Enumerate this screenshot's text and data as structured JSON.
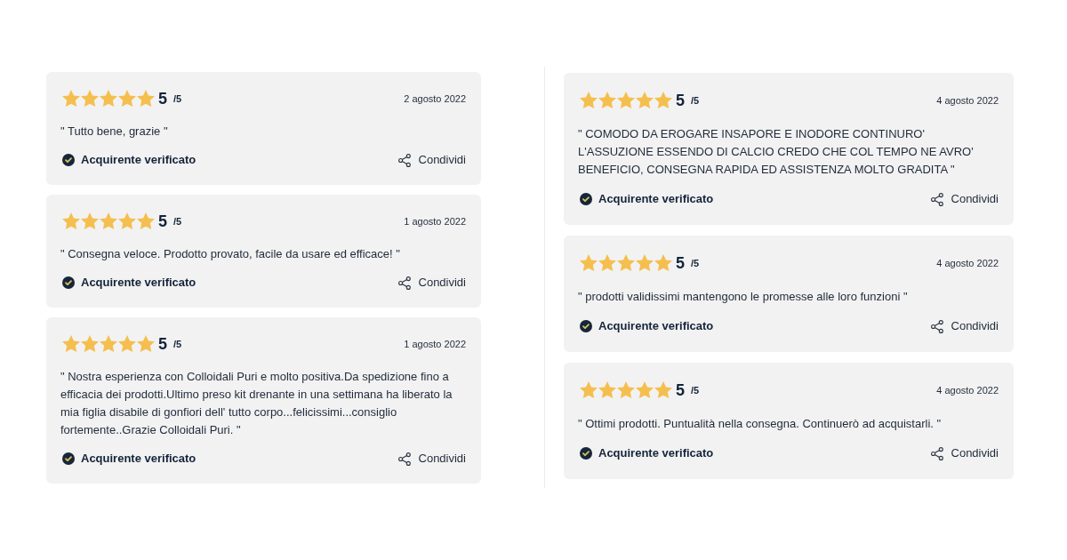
{
  "columns": [
    {
      "reviews": [
        {
          "stars": 5,
          "score": "5",
          "scale": "/5",
          "date": "2 agosto 2022",
          "text": "\" Tutto bene, grazie \"",
          "verified_label": "Acquirente verificato",
          "share_label": "Condividi"
        },
        {
          "stars": 5,
          "score": "5",
          "scale": "/5",
          "date": "1 agosto 2022",
          "text": "\" Consegna veloce. Prodotto provato, facile da usare ed efficace! \"",
          "verified_label": "Acquirente verificato",
          "share_label": "Condividi"
        },
        {
          "stars": 5,
          "score": "5",
          "scale": "/5",
          "date": "1 agosto 2022",
          "text": "\" Nostra esperienza con Colloidali Puri e molto positiva.Da spedizione fino a efficacia dei prodotti.Ultimo preso kit drenante in una settimana ha liberato la mia figlia disabile di gonfiori dell' tutto corpo...felicissimi...consiglio fortemente..Grazie Colloidali Puri. \"",
          "verified_label": "Acquirente verificato",
          "share_label": "Condividi"
        }
      ]
    },
    {
      "reviews": [
        {
          "stars": 5,
          "score": "5",
          "scale": "/5",
          "date": "4 agosto 2022",
          "text": "\" COMODO DA EROGARE INSAPORE E INODORE CONTINURO' L'ASSUZIONE ESSENDO DI CALCIO CREDO CHE COL TEMPO NE AVRO' BENEFICIO, CONSEGNA RAPIDA ED ASSISTENZA MOLTO GRADITA \"",
          "verified_label": "Acquirente verificato",
          "share_label": "Condividi"
        },
        {
          "stars": 5,
          "score": "5",
          "scale": "/5",
          "date": "4 agosto 2022",
          "text": "\" prodotti validissimi mantengono le promesse alle loro funzioni \"",
          "verified_label": "Acquirente verificato",
          "share_label": "Condividi"
        },
        {
          "stars": 5,
          "score": "5",
          "scale": "/5",
          "date": "4 agosto 2022",
          "text": "\" Ottimi prodotti. Puntualità nella consegna. Continuerò ad acquistarli. \"",
          "verified_label": "Acquirente verificato",
          "share_label": "Condividi"
        }
      ]
    }
  ]
}
